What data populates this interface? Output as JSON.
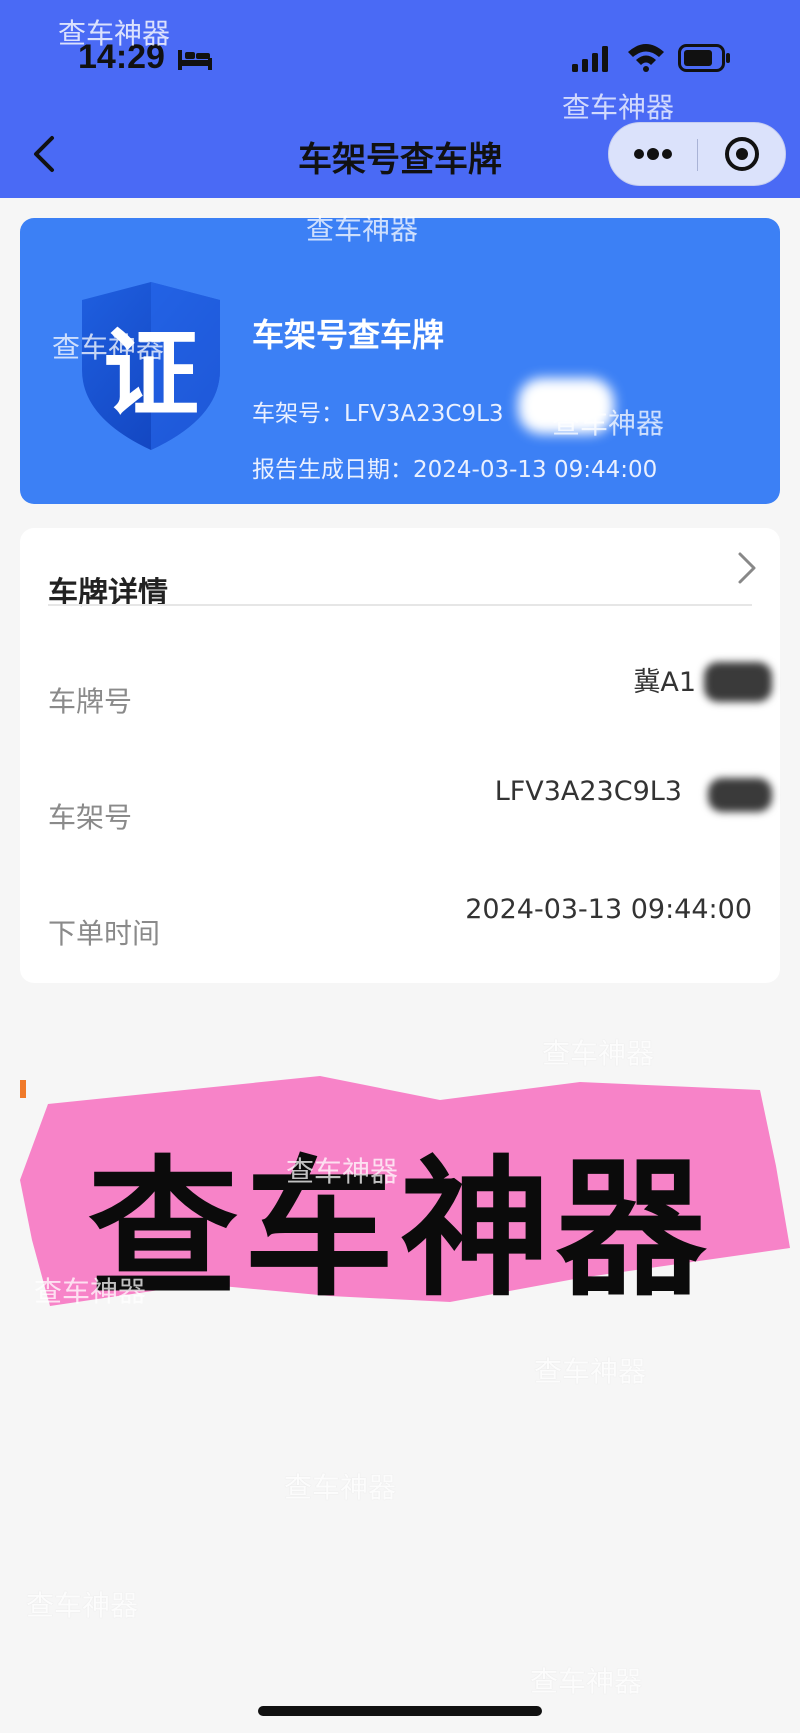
{
  "status_bar": {
    "time": "14:29"
  },
  "nav": {
    "title": "车架号查车牌"
  },
  "report_card": {
    "badge_char": "证",
    "title": "车架号查车牌",
    "vin_label": "车架号：",
    "vin_value": "LFV3A23C9L3",
    "date_label": "报告生成日期：",
    "date_value": "2024-03-13 09:44:00"
  },
  "detail_card": {
    "title": "车牌详情",
    "rows": [
      {
        "label": "车牌号",
        "value": "冀A1"
      },
      {
        "label": "车架号",
        "value": "LFV3A23C9L3"
      },
      {
        "label": "下单时间",
        "value": "2024-03-13 09:44:00"
      }
    ]
  },
  "sticker": {
    "text": "查车神器",
    "bg_color": "#f783c8"
  },
  "watermark": {
    "text": "查车神器"
  },
  "colors": {
    "nav_bg": "#4a6af5",
    "card_blue": "#3c80f5",
    "accent_orange": "#f07a2a"
  }
}
